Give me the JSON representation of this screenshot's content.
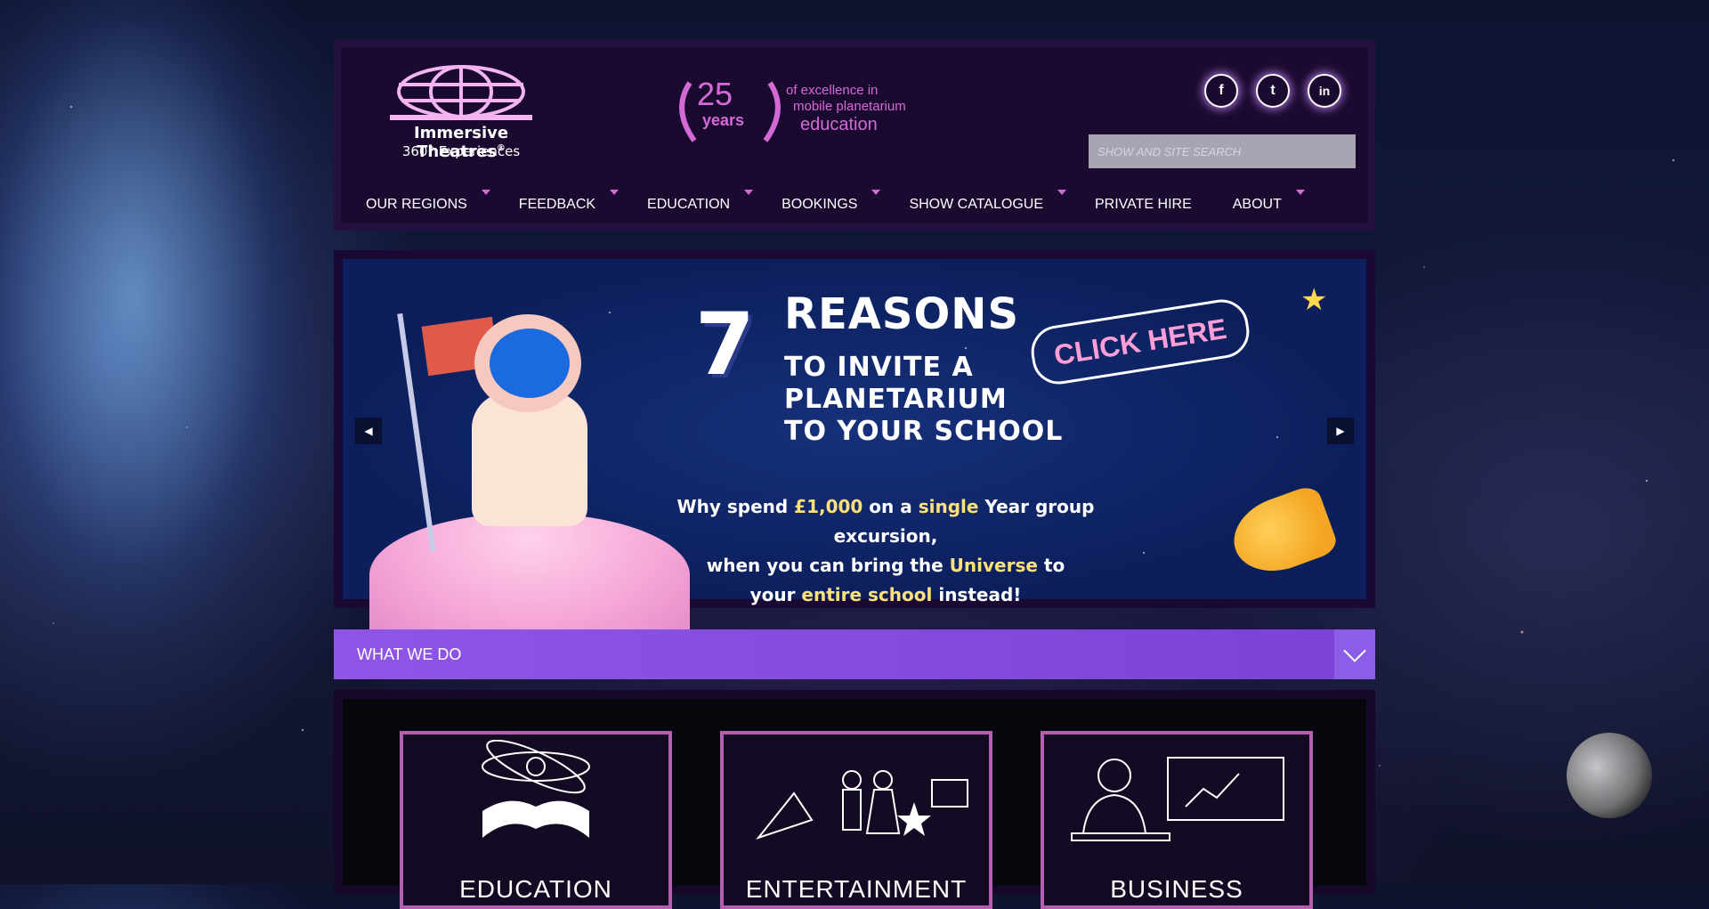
{
  "brand": {
    "logo_line1": "Immersive Theatres",
    "logo_line2": "360° Experiences",
    "registered": "®"
  },
  "badge": {
    "number": "25",
    "years": "years",
    "line1": "of excellence in",
    "line2": "mobile planetarium",
    "line3": "education"
  },
  "social": [
    {
      "icon": "facebook-icon",
      "glyph": "f"
    },
    {
      "icon": "twitter-icon",
      "glyph": "t"
    },
    {
      "icon": "linkedin-icon",
      "glyph": "in"
    }
  ],
  "search": {
    "placeholder": "SHOW AND SITE SEARCH"
  },
  "nav": [
    {
      "label": "OUR REGIONS",
      "has_dropdown": true
    },
    {
      "label": "FEEDBACK",
      "has_dropdown": true
    },
    {
      "label": "EDUCATION",
      "has_dropdown": true
    },
    {
      "label": "BOOKINGS",
      "has_dropdown": true
    },
    {
      "label": "SHOW CATALOGUE",
      "has_dropdown": true
    },
    {
      "label": "PRIVATE HIRE",
      "has_dropdown": false
    },
    {
      "label": "ABOUT",
      "has_dropdown": true
    }
  ],
  "slide": {
    "number": "7",
    "headline": "REASONS",
    "line1": "TO INVITE A",
    "line2": "PLANETARIUM",
    "line3": "TO YOUR SCHOOL",
    "cta": "CLICK HERE",
    "sub_a": "Why spend ",
    "sub_b": "£1,000",
    "sub_c": " on a ",
    "sub_d": "single",
    "sub_e": " Year group excursion,",
    "sub_f": "when you can bring the ",
    "sub_g": "Universe",
    "sub_h": " to",
    "sub_i": "your ",
    "sub_j": "entire school",
    "sub_k": " instead!"
  },
  "section": {
    "title": "WHAT WE DO"
  },
  "cards": [
    {
      "label": "EDUCATION"
    },
    {
      "label": "ENTERTAINMENT"
    },
    {
      "label": "BUSINESS"
    }
  ],
  "colors": {
    "accent": "#d36ad6",
    "bar": "#8f55e6",
    "card_border": "#b45fb0",
    "highlight": "#ffe17a"
  }
}
